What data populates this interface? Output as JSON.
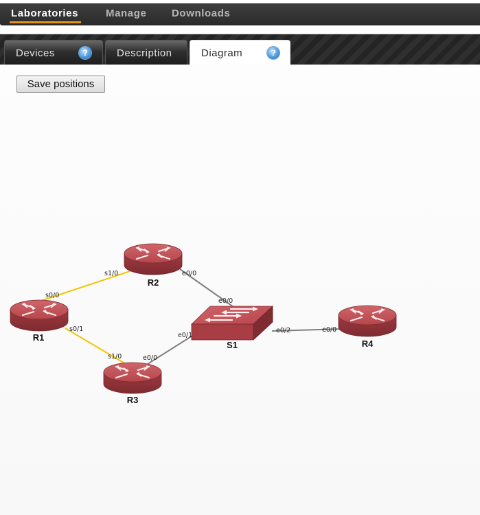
{
  "topnav": {
    "items": [
      {
        "label": "Laboratories",
        "active": true
      },
      {
        "label": "Manage",
        "active": false
      },
      {
        "label": "Downloads",
        "active": false
      }
    ]
  },
  "tabs": [
    {
      "label": "Devices",
      "help": "?",
      "active": false
    },
    {
      "label": "Description",
      "active": false
    },
    {
      "label": "Diagram",
      "help": "?",
      "active": true
    }
  ],
  "toolbar": {
    "save_label": "Save positions"
  },
  "diagram": {
    "devices": [
      {
        "name": "R1",
        "type": "router"
      },
      {
        "name": "R2",
        "type": "router"
      },
      {
        "name": "R3",
        "type": "router"
      },
      {
        "name": "R4",
        "type": "router"
      },
      {
        "name": "S1",
        "type": "switch"
      }
    ],
    "links": [
      {
        "a": "R1",
        "a_port": "s0/0",
        "b": "R2",
        "b_port": "s1/0",
        "kind": "serial"
      },
      {
        "a": "R1",
        "a_port": "s0/1",
        "b": "R3",
        "b_port": "s1/0",
        "kind": "serial"
      },
      {
        "a": "R2",
        "a_port": "e0/0",
        "b": "S1",
        "b_port": "e0/0",
        "kind": "ethernet"
      },
      {
        "a": "R3",
        "a_port": "e0/0",
        "b": "S1",
        "b_port": "e0/1",
        "kind": "ethernet"
      },
      {
        "a": "S1",
        "a_port": "e0/2",
        "b": "R4",
        "b_port": "e0/0",
        "kind": "ethernet"
      }
    ],
    "colors": {
      "serial": "#f2c400",
      "ethernet": "#808080",
      "device": "#b8454a"
    }
  }
}
